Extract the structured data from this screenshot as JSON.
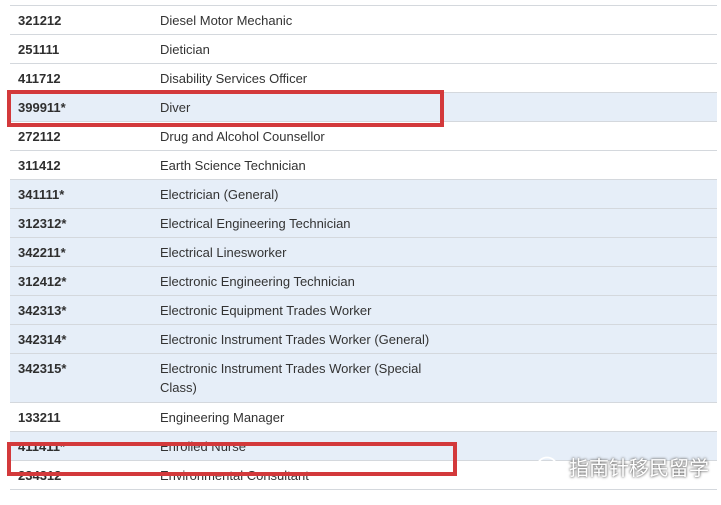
{
  "rows": [
    {
      "code": "321212",
      "title": "Diesel Motor Mechanic",
      "shaded": false,
      "tall": false
    },
    {
      "code": "251111",
      "title": "Dietician",
      "shaded": false,
      "tall": false
    },
    {
      "code": "411712",
      "title": "Disability Services Officer",
      "shaded": false,
      "tall": false
    },
    {
      "code": "399911*",
      "title": "Diver",
      "shaded": true,
      "tall": false
    },
    {
      "code": "272112",
      "title": "Drug and Alcohol Counsellor",
      "shaded": false,
      "tall": false
    },
    {
      "code": "311412",
      "title": "Earth Science Technician",
      "shaded": false,
      "tall": false
    },
    {
      "code": "341111*",
      "title": "Electrician (General)",
      "shaded": true,
      "tall": false
    },
    {
      "code": "312312*",
      "title": "Electrical Engineering Technician",
      "shaded": true,
      "tall": false
    },
    {
      "code": "342211*",
      "title": "Electrical Linesworker",
      "shaded": true,
      "tall": false
    },
    {
      "code": "312412*",
      "title": "Electronic Engineering Technician",
      "shaded": true,
      "tall": false
    },
    {
      "code": "342313*",
      "title": "Electronic Equipment Trades Worker",
      "shaded": true,
      "tall": false
    },
    {
      "code": "342314*",
      "title": "Electronic Instrument Trades Worker (General)",
      "shaded": true,
      "tall": false
    },
    {
      "code": "342315*",
      "title": "Electronic Instrument Trades Worker (Special Class)",
      "shaded": true,
      "tall": true
    },
    {
      "code": "133211",
      "title": "Engineering Manager",
      "shaded": false,
      "tall": false
    },
    {
      "code": "411411*",
      "title": "Enrolled Nurse",
      "shaded": true,
      "tall": false
    },
    {
      "code": "234312",
      "title": "Environmental Consultant",
      "shaded": false,
      "tall": false
    }
  ],
  "watermark": {
    "text": "指南针移民留学",
    "icon": "wechat-icon"
  },
  "colors": {
    "shaded_row": "#e6eef8",
    "highlight_border": "#d3393b",
    "row_border": "#d4d8dd"
  }
}
